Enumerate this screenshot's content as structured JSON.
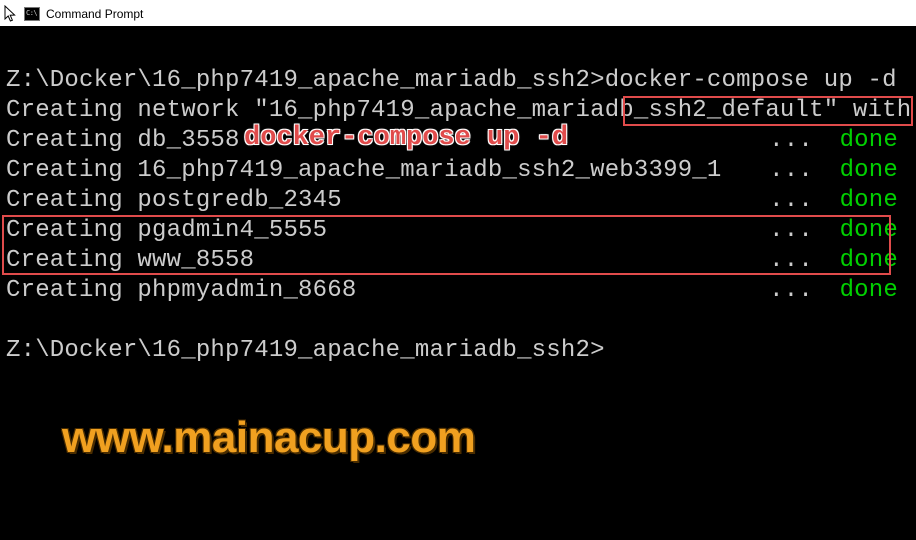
{
  "window": {
    "title": "Command Prompt"
  },
  "terminal": {
    "prompt_path": "Z:\\Docker\\16_php7419_apache_mariadb_ssh2>",
    "command": "docker-compose up -d",
    "network_line": "Creating network \"16_php7419_apache_mariadb_ssh2_default\" with",
    "services": [
      {
        "text": "Creating db_3558",
        "dots": "...",
        "status": "done"
      },
      {
        "text": "Creating 16_php7419_apache_mariadb_ssh2_web3399_1",
        "dots": "...",
        "status": "done"
      },
      {
        "text": "Creating postgredb_2345",
        "dots": "...",
        "status": "done"
      },
      {
        "text": "Creating pgadmin4_5555",
        "dots": "...",
        "status": "done"
      },
      {
        "text": "Creating www_8558",
        "dots": "...",
        "status": "done"
      },
      {
        "text": "Creating phpmyadmin_8668",
        "dots": "...",
        "status": "done"
      }
    ],
    "prompt2": "Z:\\Docker\\16_php7419_apache_mariadb_ssh2>"
  },
  "overlay": {
    "command_annotation": "docker-compose up -d",
    "watermark": "www.mainacup.com"
  },
  "colors": {
    "done": "#00d000",
    "highlight": "#e04b4b",
    "watermark": "#f0a020"
  }
}
